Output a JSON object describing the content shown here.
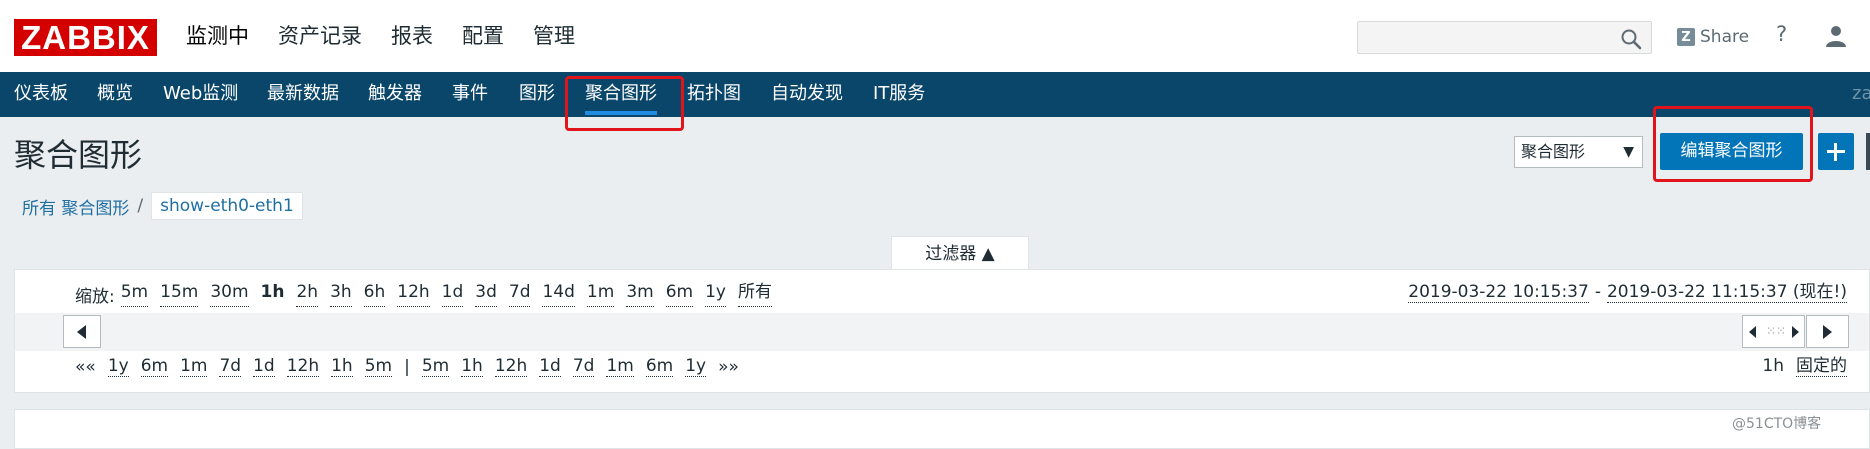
{
  "header": {
    "logo": "ZABBIX",
    "menu": [
      "监测中",
      "资产记录",
      "报表",
      "配置",
      "管理"
    ],
    "search_placeholder": "",
    "share_label": "Share",
    "help_label": "?"
  },
  "subnav": {
    "items": [
      "仪表板",
      "概览",
      "Web监测",
      "最新数据",
      "触发器",
      "事件",
      "图形",
      "聚合图形",
      "拓扑图",
      "自动发现",
      "IT服务"
    ],
    "active": "聚合图形",
    "user_tail": "za"
  },
  "page": {
    "title": "聚合图形",
    "select_value": "聚合图形",
    "edit_button": "编辑聚合图形"
  },
  "breadcrumb": {
    "all": "所有 聚合图形",
    "separator": "/",
    "current": "show-eth0-eth1"
  },
  "filter": {
    "tab_label": "过滤器 ▲",
    "zoom_label": "缩放:",
    "zoom_options": [
      "5m",
      "15m",
      "30m",
      "1h",
      "2h",
      "3h",
      "6h",
      "12h",
      "1d",
      "3d",
      "7d",
      "14d",
      "1m",
      "3m",
      "6m",
      "1y",
      "所有"
    ],
    "zoom_active": "1h",
    "date_from": "2019-03-22 10:15:37",
    "date_dash": "-",
    "date_to": "2019-03-22 11:15:37 (现在!)",
    "back_prefix": "««",
    "back_options": [
      "1y",
      "6m",
      "1m",
      "7d",
      "1d",
      "12h",
      "1h",
      "5m"
    ],
    "divider": "|",
    "forward_options": [
      "5m",
      "1h",
      "12h",
      "1d",
      "7d",
      "1m",
      "6m",
      "1y"
    ],
    "forward_suffix": "»»",
    "period_value": "1h",
    "period_fixed": "固定的"
  },
  "watermark": "@51CTO博客",
  "colors": {
    "nav_bg": "#0a466a",
    "accent": "#0275b8",
    "logo_bg": "#d40000",
    "annotation": "#e1141b"
  }
}
